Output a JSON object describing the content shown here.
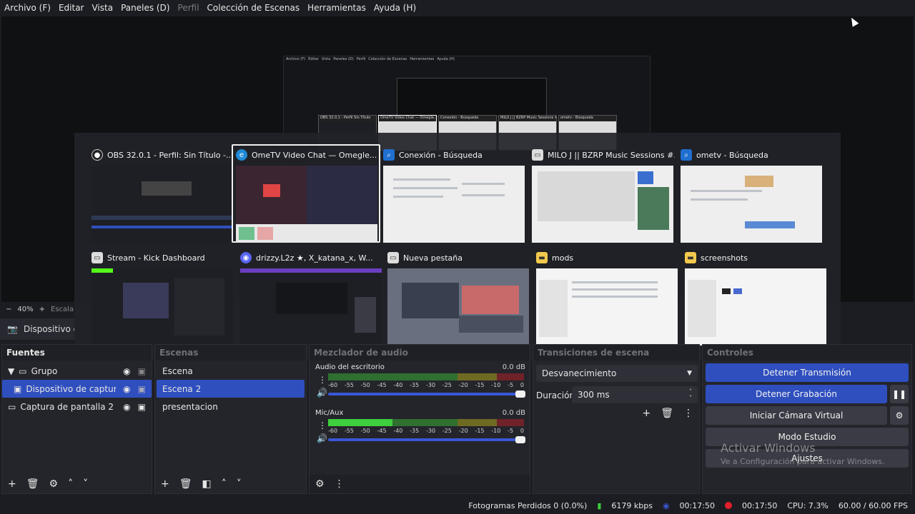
{
  "menu": [
    "Archivo (F)",
    "Editar",
    "Vista",
    "Paneles (D)",
    "Perfil",
    "Colección de Escenas",
    "Herramientas",
    "Ayuda (H)"
  ],
  "menu_disabled_index": 4,
  "nested_menu": [
    "Archivo (F)",
    "Editar",
    "Vista",
    "Paneles (D)",
    "Perfil",
    "Colección de Escenas",
    "Herramientas",
    "Ayuda (H)"
  ],
  "nested_windows": [
    "OBS 32.0.1 - Perfil Sin Título",
    "OmeTV Video Chat — Omegle...",
    "Conexión - Búsqueda",
    "MILO J || BZRP Music Sessions #...",
    "ometv - Búsqueda"
  ],
  "switcher": {
    "windows": [
      {
        "title": "OBS 32.0.1 - Perfil: Sin Título -...",
        "icon": "obs-icon",
        "dark": true
      },
      {
        "title": "OmeTV Video Chat — Omegle...",
        "icon": "edge-icon",
        "dark": false,
        "selected": true
      },
      {
        "title": "Conexión - Búsqueda",
        "icon": "search-icon",
        "dark": false
      },
      {
        "title": "MILO J || BZRP Music Sessions #...",
        "icon": "browser-tab-icon",
        "dark": false
      },
      {
        "title": "ometv - Búsqueda",
        "icon": "search-icon",
        "dark": false
      },
      {
        "title": "Stream - Kick Dashboard",
        "icon": "browser-tab-icon",
        "dark": true
      },
      {
        "title": "drizzy.L2z ★, X_katana_x, W...",
        "icon": "discord-icon",
        "dark": true
      },
      {
        "title": "Nueva pestaña",
        "icon": "browser-tab-icon",
        "dark": false
      },
      {
        "title": "mods",
        "icon": "folder-icon",
        "dark": false
      },
      {
        "title": "screenshots",
        "icon": "folder-icon",
        "dark": false
      }
    ]
  },
  "zoom": {
    "minus": "−",
    "value": "40%",
    "plus": "+",
    "scale": "Escala"
  },
  "source_bar": {
    "label": "Dispositivo de capt"
  },
  "fuentes": {
    "title": "Fuentes",
    "items": [
      {
        "label": "Grupo"
      },
      {
        "label": "Dispositivo de captura de"
      },
      {
        "label": "Captura de pantalla 2"
      }
    ]
  },
  "escenas": {
    "title": "Escenas",
    "items": [
      "Escena",
      "Escena 2",
      "presentacion"
    ]
  },
  "mezclador": {
    "title": "Mezclador de audio",
    "channels": [
      {
        "name": "Audio del escritorio",
        "db": "0.0 dB",
        "level": 0.0
      },
      {
        "name": "Mic/Aux",
        "db": "0.0 dB",
        "level": 0.33
      }
    ],
    "ticks": [
      "-60",
      "-55",
      "-50",
      "-45",
      "-40",
      "-35",
      "-30",
      "-25",
      "-20",
      "-15",
      "-10",
      "-5",
      "0"
    ]
  },
  "transiciones": {
    "title": "Transiciones de escena",
    "selected": "Desvanecimiento",
    "duration_label": "Duración",
    "duration_value": "300 ms"
  },
  "controles": {
    "title": "Controles",
    "stop_stream": "Detener Transmisión",
    "stop_record": "Detener Grabación",
    "virtual_cam": "Iniciar Cámara Virtual",
    "studio_mode": "Modo Estudio",
    "settings": "Ajustes"
  },
  "status": {
    "dropped": "Fotogramas Perdidos 0 (0.0%)",
    "bitrate": "6179 kbps",
    "stream_time": "00:17:50",
    "rec_time": "00:17:50",
    "cpu": "CPU: 7.3%",
    "fps": "60.00 / 60.00 FPS"
  },
  "watermark": {
    "line1": "Activar Windows",
    "line2": "Ve a Configuración para activar Windows."
  },
  "colors": {
    "accent": "#2f4fbf",
    "record": "#e0202a",
    "live": "#3957d6"
  }
}
